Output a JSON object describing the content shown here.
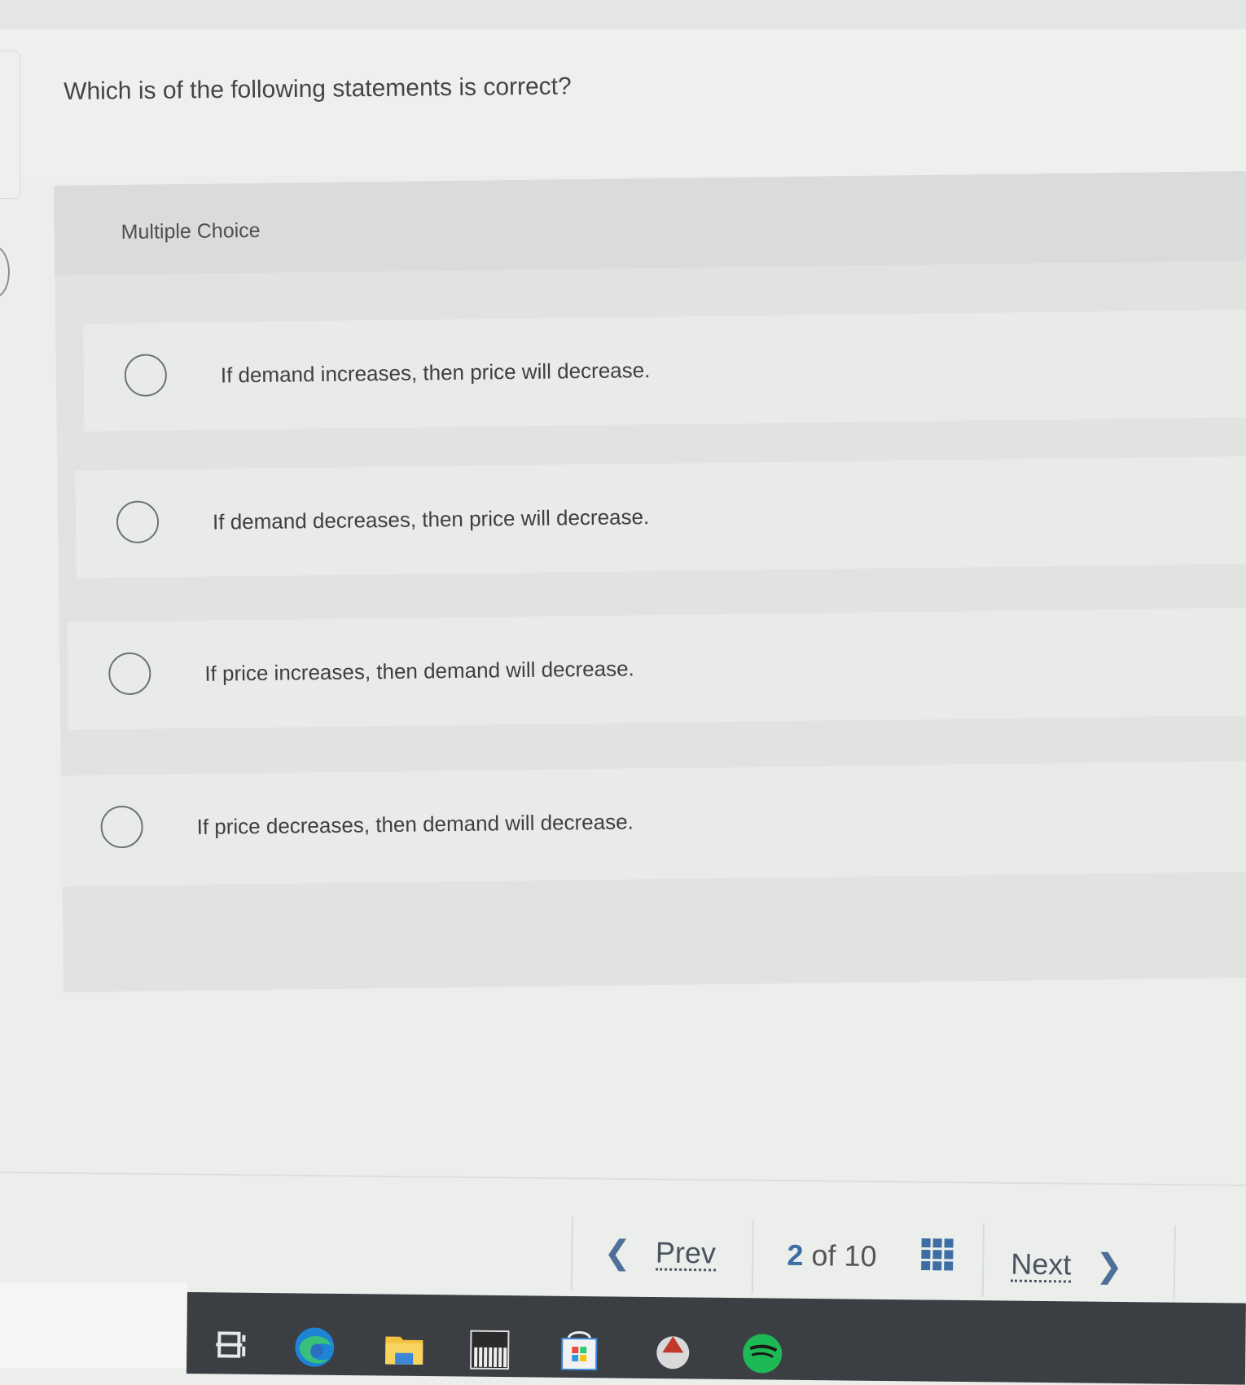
{
  "question": {
    "text": "Which is of the following statements is correct?"
  },
  "multiple_choice": {
    "title": "Multiple Choice",
    "options": [
      {
        "label": "If demand increases, then price will decrease."
      },
      {
        "label": "If demand decreases, then price will decrease."
      },
      {
        "label": "If price increases, then demand will decrease."
      },
      {
        "label": "If price decreases, then demand will decrease."
      }
    ]
  },
  "navigation": {
    "prev_label": "Prev",
    "next_label": "Next",
    "current_page": "2",
    "of_label": "of",
    "total_pages": "10",
    "prev_icon": "chevron-left-icon",
    "next_icon": "chevron-right-icon",
    "grid_icon": "question-grid-icon",
    "accent_color": "#3d6ea3"
  },
  "taskbar": {
    "icons": [
      "task-view-icon",
      "edge-browser-icon",
      "file-explorer-icon",
      "piano-app-icon",
      "store-icon",
      "app-icon",
      "spotify-icon"
    ]
  }
}
